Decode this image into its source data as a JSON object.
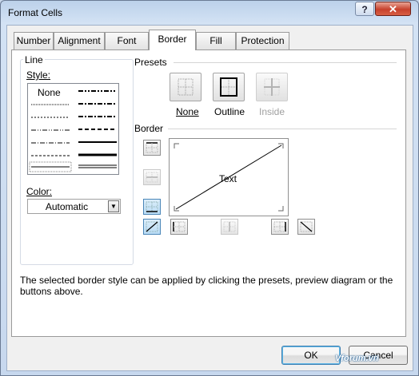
{
  "window": {
    "title": "Format Cells",
    "help_label": "?",
    "close_label": "✕"
  },
  "tabs": [
    {
      "label": "Number"
    },
    {
      "label": "Alignment"
    },
    {
      "label": "Font"
    },
    {
      "label": "Border",
      "active": true
    },
    {
      "label": "Fill"
    },
    {
      "label": "Protection"
    }
  ],
  "line": {
    "group_label": "Line",
    "style_label": "Style:",
    "none_label": "None",
    "color_label": "Color:",
    "color_value": "Automatic"
  },
  "presets": {
    "group_label": "Presets",
    "items": [
      {
        "label": "None",
        "icon": "preset-none-icon"
      },
      {
        "label": "Outline",
        "icon": "preset-outline-icon"
      },
      {
        "label": "Inside",
        "icon": "preset-inside-icon",
        "disabled": true
      }
    ]
  },
  "border": {
    "group_label": "Border",
    "preview_text": "Text"
  },
  "hint": "The selected border style can be applied by clicking the presets, preview diagram or the buttons above.",
  "buttons": {
    "ok": "OK",
    "cancel": "Cancel"
  },
  "watermark": "Vforum.vn",
  "colors": {
    "accent": "#3c7fb1",
    "selected_border_button": "#b9dcf5",
    "title_bar": "#bcd1ea"
  }
}
